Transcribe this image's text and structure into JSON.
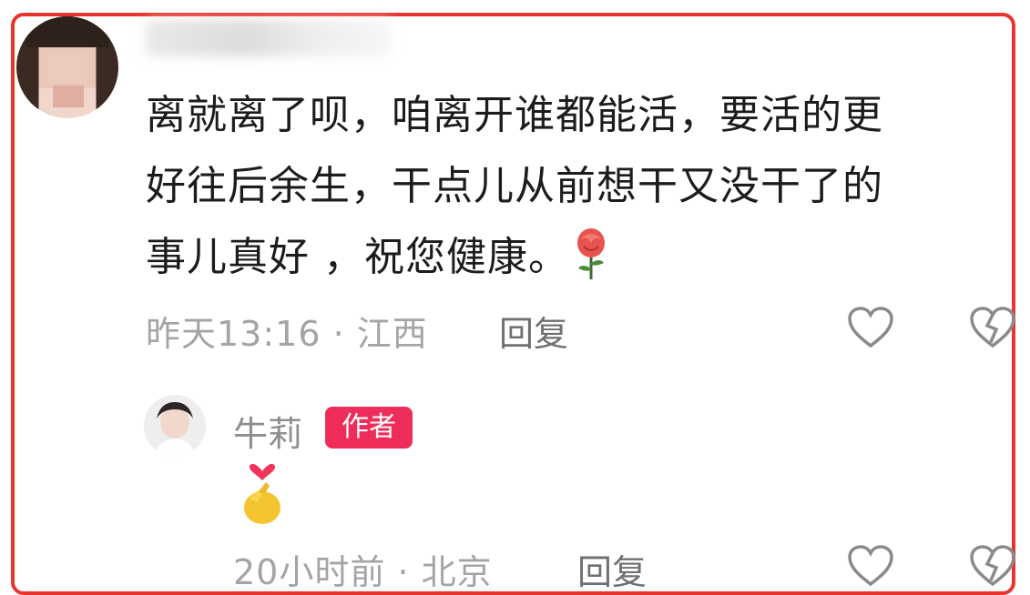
{
  "comment": {
    "line1": "离就离了呗，咱离开谁都能活，要活的更",
    "line2": "好往后余生，干点儿从前想干又没干了的",
    "line3": "事儿真好 ，祝您健康。",
    "time": "昨天13:16",
    "location": "江西",
    "separator": "·",
    "reply_label": "回复",
    "emoji_icon": "rose-emoji"
  },
  "reply": {
    "username": "牛莉",
    "author_badge": "作者",
    "emoji_icon": "finger-heart-emoji",
    "time": "20小时前",
    "location": "北京",
    "separator": "·",
    "reply_label": "回复"
  },
  "colors": {
    "border": "#e8342e",
    "badge": "#ee2d5a",
    "meta_text": "#a4a4a4"
  }
}
